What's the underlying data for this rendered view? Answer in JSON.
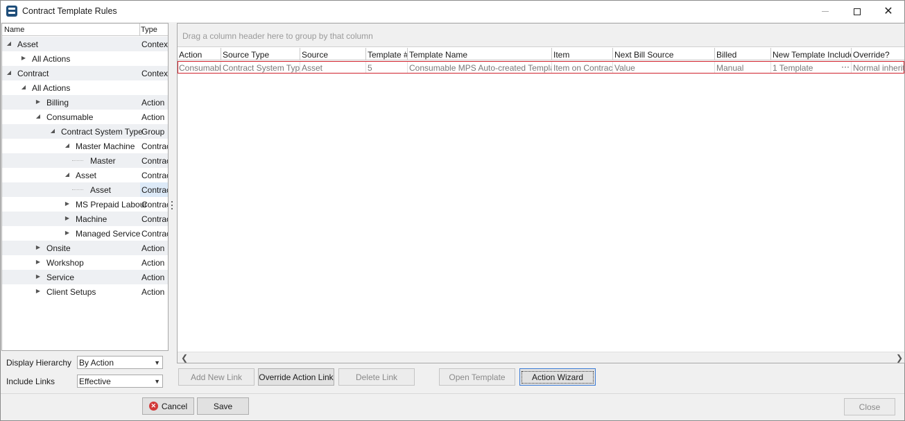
{
  "window": {
    "title": "Contract Template Rules"
  },
  "tree": {
    "columns": {
      "name": "Name",
      "type": "Type"
    },
    "rows": [
      {
        "name": "Asset",
        "type": "Context",
        "level": 0,
        "expander": "expanded"
      },
      {
        "name": "All Actions",
        "type": "",
        "level": 1,
        "expander": "collapsed"
      },
      {
        "name": "Contract",
        "type": "Context",
        "level": 0,
        "expander": "expanded"
      },
      {
        "name": "All Actions",
        "type": "",
        "level": 1,
        "expander": "expanded"
      },
      {
        "name": "Billing",
        "type": "Action",
        "level": 2,
        "expander": "collapsed"
      },
      {
        "name": "Consumable",
        "type": "Action",
        "level": 2,
        "expander": "expanded"
      },
      {
        "name": "Contract System Type",
        "type": "Group",
        "level": 3,
        "expander": "expanded"
      },
      {
        "name": "Master Machine",
        "type": "Contract",
        "level": 4,
        "expander": "expanded"
      },
      {
        "name": "Master",
        "type": "Contract",
        "level": 5,
        "expander": "none"
      },
      {
        "name": "Asset",
        "type": "Contract",
        "level": 4,
        "expander": "expanded"
      },
      {
        "name": "Asset",
        "type": "Contract",
        "level": 5,
        "expander": "none",
        "selected": true
      },
      {
        "name": "MS Prepaid Labour",
        "type": "Contract",
        "level": 4,
        "expander": "collapsed"
      },
      {
        "name": "Machine",
        "type": "Contract",
        "level": 4,
        "expander": "collapsed"
      },
      {
        "name": "Managed Service",
        "type": "Contract",
        "level": 4,
        "expander": "collapsed"
      },
      {
        "name": "Onsite",
        "type": "Action",
        "level": 2,
        "expander": "collapsed"
      },
      {
        "name": "Workshop",
        "type": "Action",
        "level": 2,
        "expander": "collapsed"
      },
      {
        "name": "Service",
        "type": "Action",
        "level": 2,
        "expander": "collapsed"
      },
      {
        "name": "Client Setups",
        "type": "Action",
        "level": 2,
        "expander": "collapsed"
      }
    ]
  },
  "options": {
    "display_hierarchy_label": "Display Hierarchy",
    "display_hierarchy_value": "By Action",
    "include_links_label": "Include Links",
    "include_links_value": "Effective"
  },
  "grid": {
    "group_hint": "Drag a column header here to group by that column",
    "columns": [
      "Action",
      "Source Type",
      "Source",
      "Template #",
      "Template Name",
      "Item",
      "Next Bill Source",
      "Billed",
      "New Template Includes",
      "Override?"
    ],
    "rows": [
      [
        "Consumable",
        "Contract System Type",
        "Asset",
        "5",
        "Consumable MPS Auto-created Template",
        "Item on Contract",
        "Value",
        "Manual",
        "1 Template",
        "Normal inherita"
      ]
    ],
    "ellipsis": "···"
  },
  "actions": {
    "add_new_link": "Add New Link",
    "override_action_link": "Override Action Link",
    "delete_link": "Delete Link",
    "open_template": "Open Template",
    "action_wizard": "Action Wizard"
  },
  "footer": {
    "cancel": "Cancel",
    "save": "Save",
    "close": "Close"
  }
}
